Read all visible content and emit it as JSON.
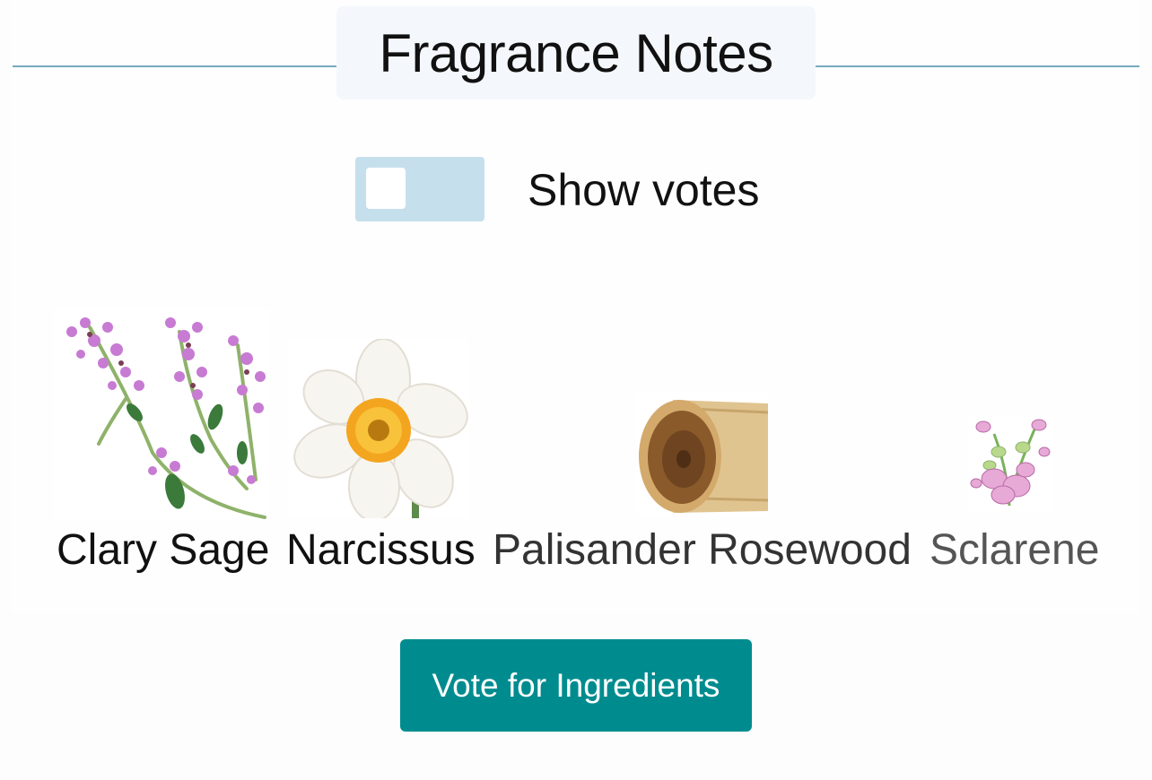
{
  "section": {
    "title": "Fragrance Notes"
  },
  "votes_toggle": {
    "label": "Show votes",
    "on": false
  },
  "notes": [
    {
      "name": "Clary Sage",
      "color": "#111111",
      "icon": "clary-sage-image"
    },
    {
      "name": "Narcissus",
      "color": "#111111",
      "icon": "narcissus-image"
    },
    {
      "name": "Palisander Rosewood",
      "color": "#333333",
      "icon": "rosewood-log-image"
    },
    {
      "name": "Sclarene",
      "color": "#555555",
      "icon": "sclarene-plant-image"
    }
  ],
  "vote_button": {
    "label": "Vote for Ingredients"
  },
  "colors": {
    "accent": "#008c8f",
    "rule": "#76aabc",
    "toggle_track": "#c6dfed"
  }
}
